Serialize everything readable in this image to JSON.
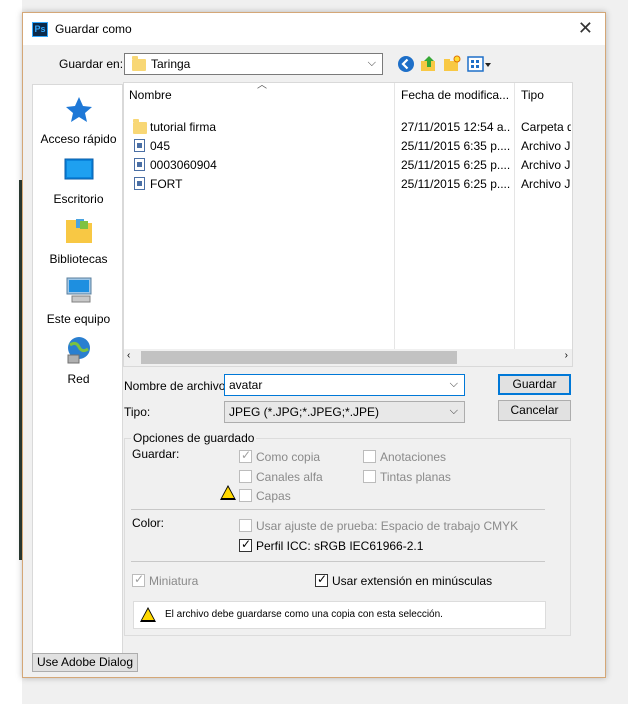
{
  "window": {
    "title": "Guardar como",
    "app_icon": "Ps"
  },
  "save_in": {
    "label": "Guardar en:",
    "value": "Taringa"
  },
  "toolbar": {
    "icons": [
      "back-icon",
      "up-folder-icon",
      "new-folder-icon",
      "view-menu-icon"
    ]
  },
  "places": [
    {
      "label": "Acceso rápido",
      "icon": "star-icon"
    },
    {
      "label": "Escritorio",
      "icon": "desktop-icon"
    },
    {
      "label": "Bibliotecas",
      "icon": "libraries-icon"
    },
    {
      "label": "Este equipo",
      "icon": "computer-icon"
    },
    {
      "label": "Red",
      "icon": "network-icon"
    }
  ],
  "filelist": {
    "columns": [
      "Nombre",
      "Fecha de modifica...",
      "Tipo"
    ],
    "rows": [
      {
        "name": "tutorial firma",
        "date": "27/11/2015 12:54 a...",
        "type": "Carpeta d",
        "icon": "folder"
      },
      {
        "name": "045",
        "date": "25/11/2015 6:35 p....",
        "type": "Archivo JP",
        "icon": "jpg"
      },
      {
        "name": "0003060904",
        "date": "25/11/2015 6:25 p....",
        "type": "Archivo JP",
        "icon": "jpg"
      },
      {
        "name": "FORT",
        "date": "25/11/2015 6:25 p....",
        "type": "Archivo JP",
        "icon": "jpg"
      }
    ]
  },
  "filename": {
    "label": "Nombre de archivo:",
    "value": "avatar"
  },
  "filetype": {
    "label": "Tipo:",
    "value": "JPEG (*.JPG;*.JPEG;*.JPE)"
  },
  "buttons": {
    "save": "Guardar",
    "cancel": "Cancelar",
    "adobe": "Use Adobe Dialog"
  },
  "options": {
    "legend": "Opciones de guardado",
    "save_label": "Guardar:",
    "as_copy": "Como copia",
    "alpha": "Canales alfa",
    "layers": "Capas",
    "annotations": "Anotaciones",
    "spot": "Tintas planas",
    "color_label": "Color:",
    "proof": "Usar ajuste de prueba: Espacio de trabajo CMYK",
    "icc": "Perfil ICC: sRGB IEC61966-2.1",
    "thumbnail": "Miniatura",
    "lowercase": "Usar extensión en minúsculas",
    "message": "El archivo debe guardarse como una copia con esta selección."
  }
}
